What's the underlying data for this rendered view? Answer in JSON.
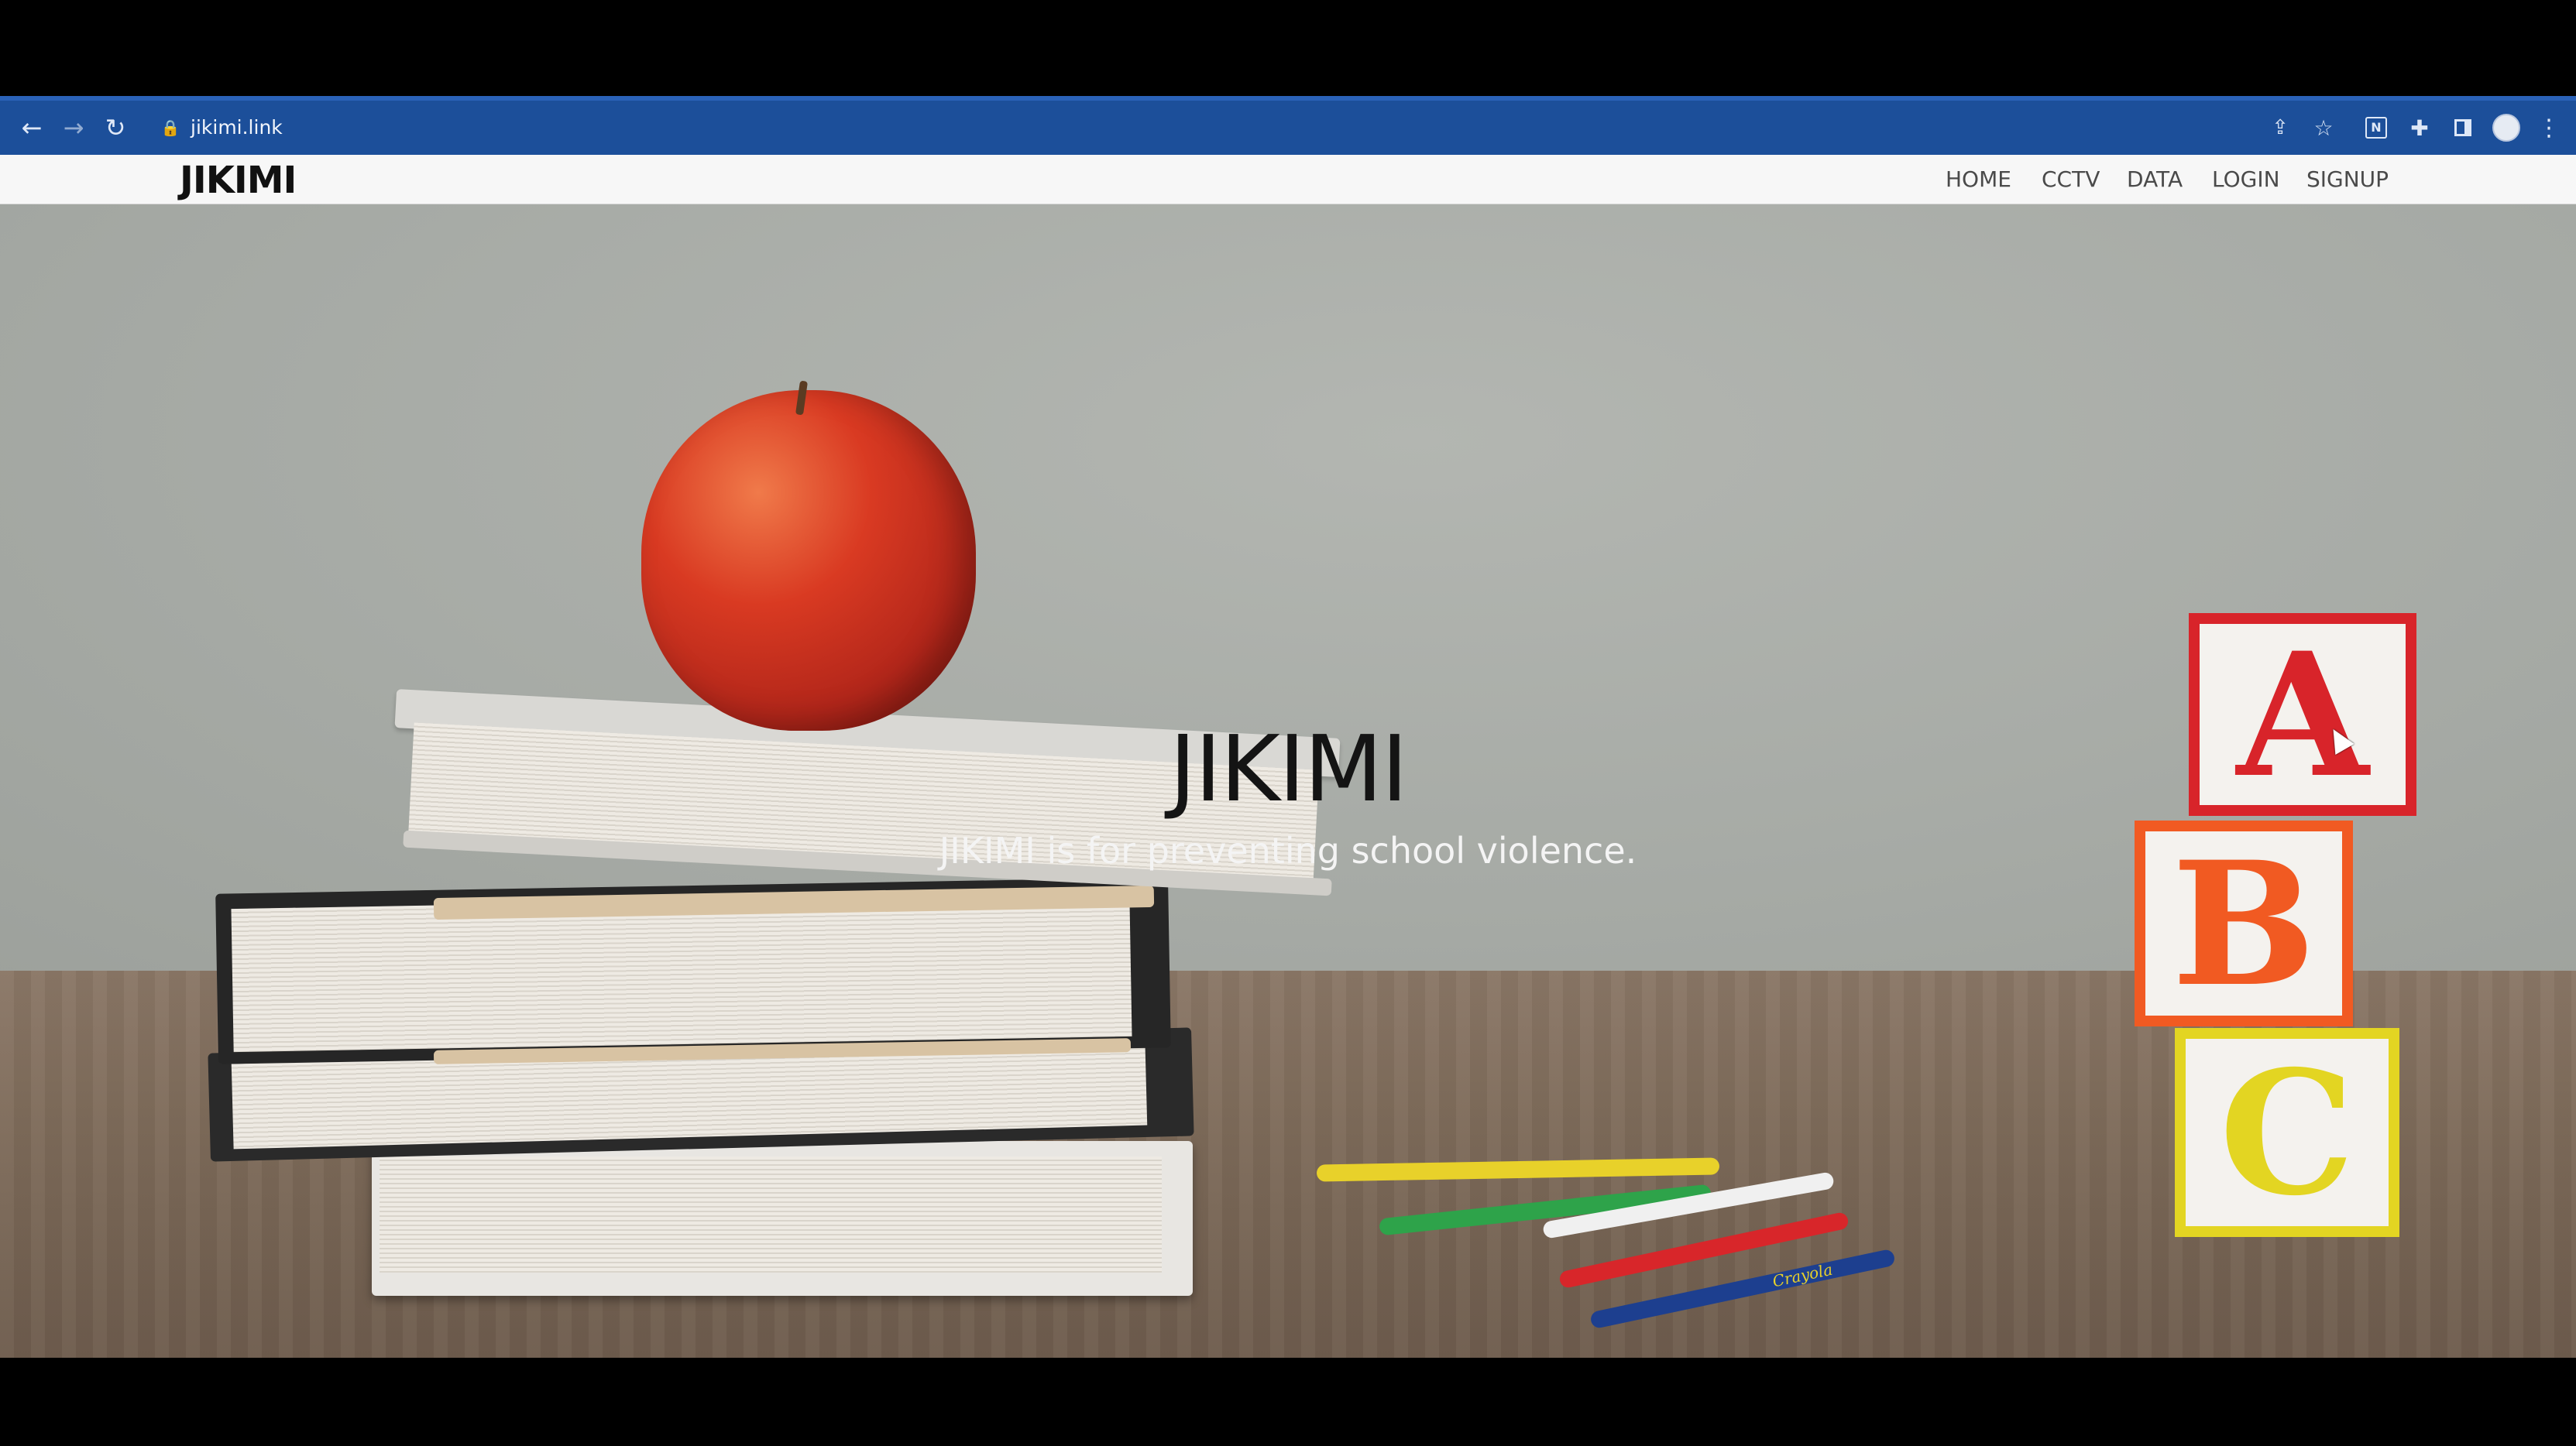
{
  "browser": {
    "url": "jikimi.link",
    "colors": {
      "toolbar": "#1c4f9a"
    }
  },
  "navbar": {
    "brand": "JIKIMI",
    "links": [
      {
        "label": "HOME"
      },
      {
        "label": "CCTV"
      },
      {
        "label": "DATA"
      },
      {
        "label": "LOGIN"
      },
      {
        "label": "SIGNUP"
      }
    ]
  },
  "hero": {
    "title": "JIKIMI",
    "subtitle": "JIKIMI is for preventing school violence.",
    "blocks": [
      "A",
      "B",
      "C"
    ],
    "pencil_brand": "Crayola"
  }
}
